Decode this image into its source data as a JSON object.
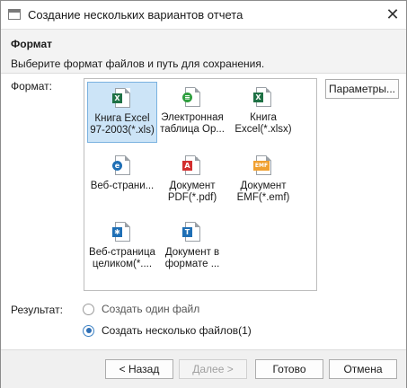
{
  "window": {
    "title": "Создание нескольких вариантов отчета",
    "close_glyph": "✕"
  },
  "header": {
    "section_title": "Формат",
    "description": "Выберите формат файлов и путь для сохранения."
  },
  "format": {
    "label": "Формат:",
    "params_button": "Параметры...",
    "items": [
      {
        "label": "Книга Excel\n97-2003(*.xls)",
        "icon": "excel-xls-icon",
        "color": "#1e7145",
        "selected": true
      },
      {
        "label": "Электронная\nтаблица Op...",
        "icon": "openoffice-spreadsheet-icon",
        "color": "#2e9e3e",
        "selected": false
      },
      {
        "label": "Книга\nExcel(*.xlsx)",
        "icon": "excel-xlsx-icon",
        "color": "#1e7145",
        "selected": false
      },
      {
        "label": "Веб-страни...",
        "icon": "web-page-icon",
        "color": "#1f6fb5",
        "selected": false
      },
      {
        "label": "Документ\nPDF(*.pdf)",
        "icon": "pdf-icon",
        "color": "#d32f2f",
        "selected": false
      },
      {
        "label": "Документ\nEMF(*.emf)",
        "icon": "emf-icon",
        "color": "#f0a030",
        "selected": false
      },
      {
        "label": "Веб-страница\nцеликом(*....",
        "icon": "web-archive-icon",
        "color": "#1f6fb5",
        "selected": false
      },
      {
        "label": "Документ в\nформате ...",
        "icon": "text-document-icon",
        "color": "#1f6fb5",
        "selected": false
      }
    ]
  },
  "result": {
    "label": "Результат:",
    "options": [
      {
        "label": "Создать один файл",
        "checked": false
      },
      {
        "label": "Создать несколько файлов(1)",
        "checked": true
      }
    ]
  },
  "footer": {
    "back": "< Назад",
    "next": "Далее >",
    "done": "Готово",
    "cancel": "Отмена"
  }
}
